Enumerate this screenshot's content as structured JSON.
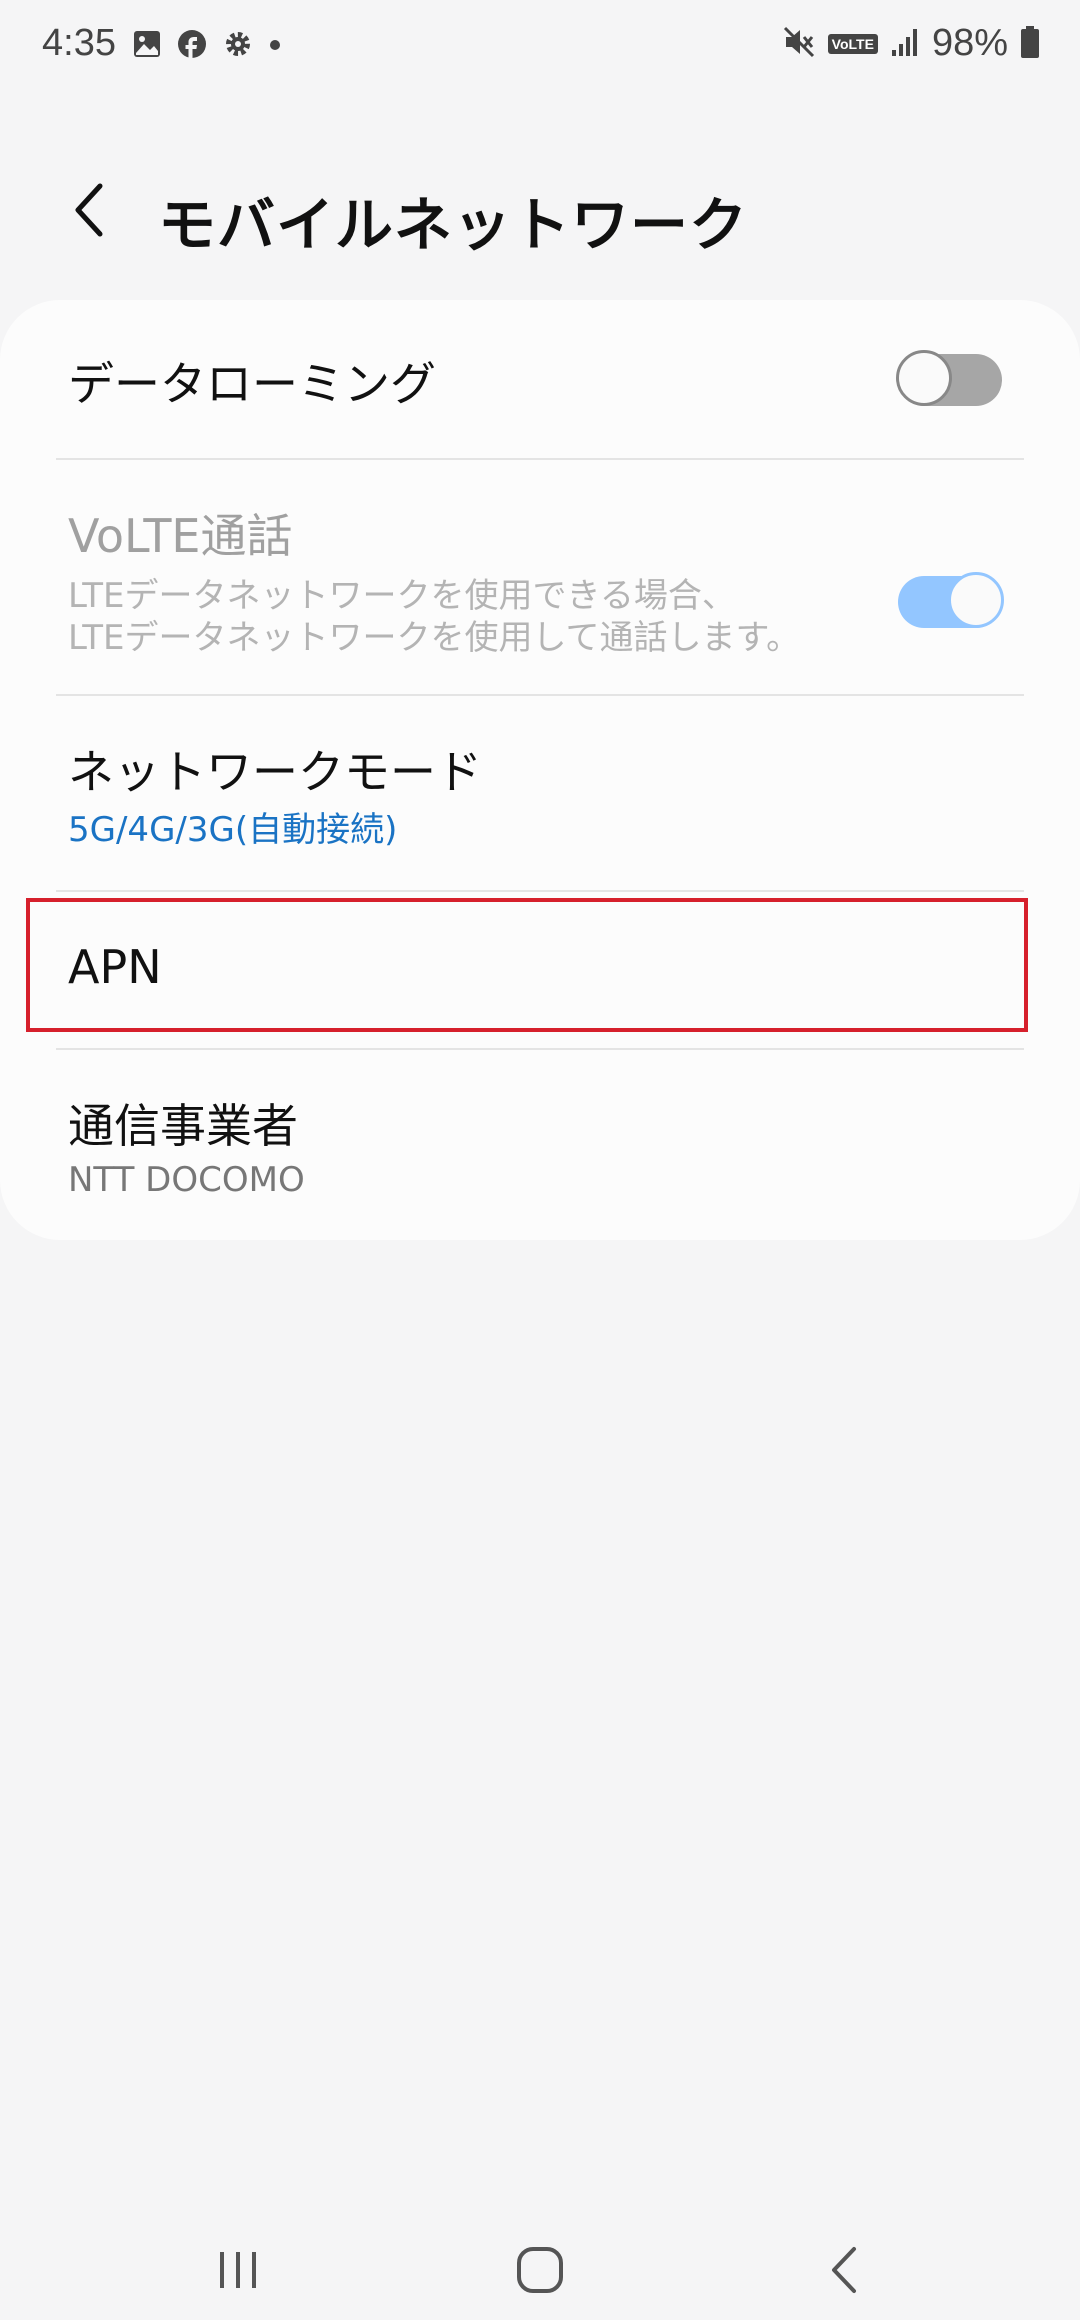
{
  "status_bar": {
    "time": "4:35",
    "battery": "98%",
    "volte": "VoLTE"
  },
  "header": {
    "title": "モバイルネットワーク"
  },
  "settings": {
    "data_roaming": {
      "title": "データローミング",
      "enabled": false
    },
    "volte": {
      "title": "VoLTE通話",
      "subtitle_line1": "LTEデータネットワークを使用できる場合、",
      "subtitle_line2": "LTEデータネットワークを使用して通話します。",
      "enabled": true
    },
    "network_mode": {
      "title": "ネットワークモード",
      "value": "5G/4G/3G(自動接続)"
    },
    "apn": {
      "title": "APN"
    },
    "carrier": {
      "title": "通信事業者",
      "value": "NTT DOCOMO"
    }
  },
  "colors": {
    "accent_blue": "#1a73c4",
    "switch_on": "#93c6ff",
    "highlight_red": "#d6202c"
  }
}
